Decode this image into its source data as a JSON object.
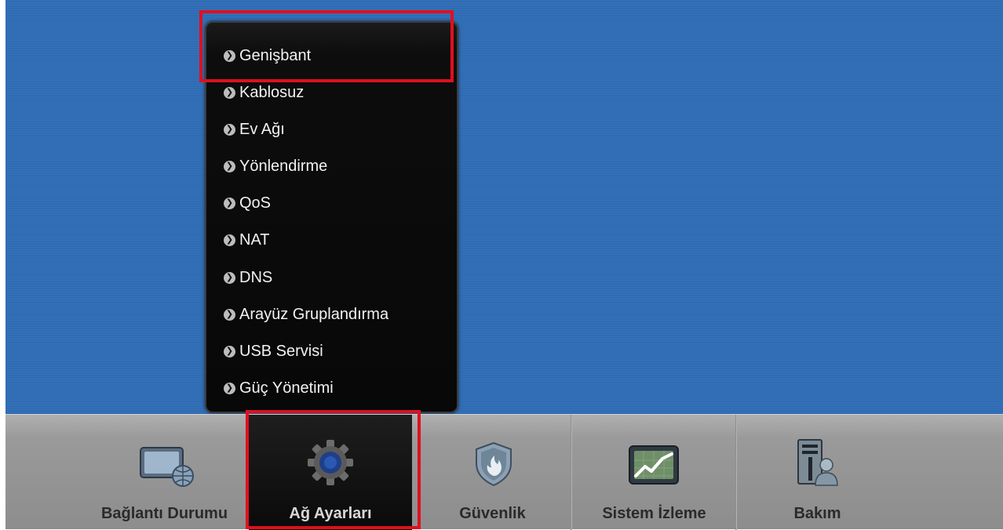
{
  "menu": {
    "items": [
      {
        "label": "Genişbant"
      },
      {
        "label": "Kablosuz"
      },
      {
        "label": "Ev Ağı"
      },
      {
        "label": "Yönlendirme"
      },
      {
        "label": "QoS"
      },
      {
        "label": "NAT"
      },
      {
        "label": "DNS"
      },
      {
        "label": "Arayüz Gruplandırma"
      },
      {
        "label": "USB Servisi"
      },
      {
        "label": "Güç Yönetimi"
      }
    ],
    "bullet_icon": "chevron-right-icon"
  },
  "navbar": {
    "items": [
      {
        "label": "Bağlantı Durumu",
        "icon": "monitor-globe-icon"
      },
      {
        "label": "Ağ Ayarları",
        "icon": "gear-icon",
        "active": true
      },
      {
        "label": "Güvenlik",
        "icon": "shield-flame-icon"
      },
      {
        "label": "Sistem İzleme",
        "icon": "monitor-chart-icon"
      },
      {
        "label": "Bakım",
        "icon": "maintenance-person-icon"
      }
    ]
  },
  "colors": {
    "desktop_bg": "#2f6cb4",
    "highlight": "#e0101e",
    "menu_bg": "#0d0d0d",
    "navbar_bg": "#9a9a9a"
  }
}
